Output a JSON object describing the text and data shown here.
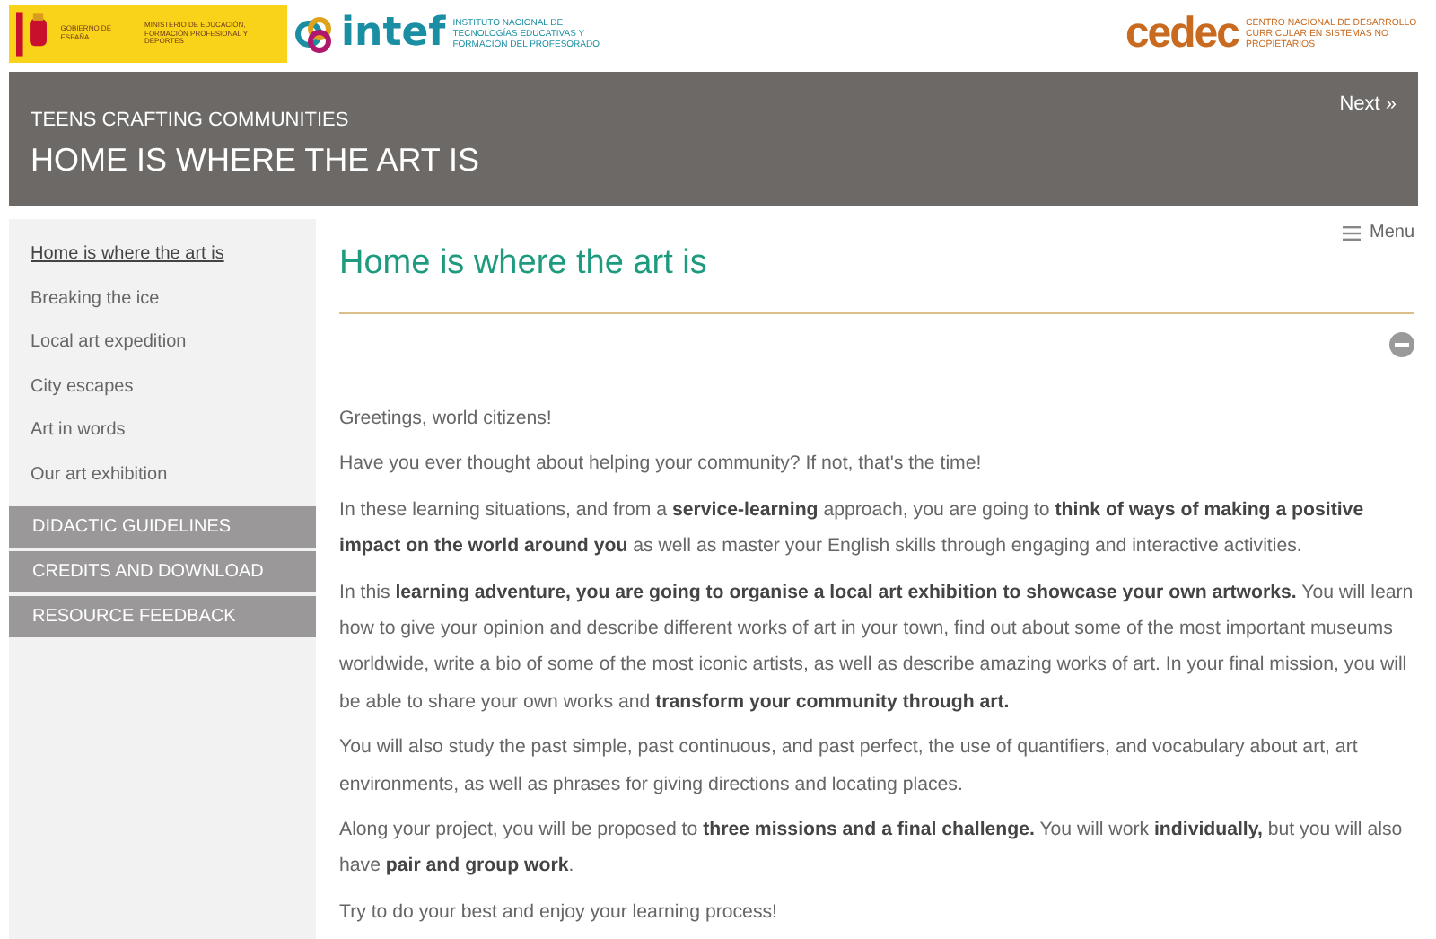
{
  "logos": {
    "gobierno": "GOBIERNO DE ESPAÑA",
    "ministerio": "MINISTERIO DE EDUCACIÓN, FORMACIÓN PROFESIONAL Y DEPORTES",
    "intef": "intef",
    "intef_caption": "INSTITUTO NACIONAL DE TECNOLOGÍAS EDUCATIVAS Y FORMACIÓN DEL PROFESORADO",
    "cedec": "cedec",
    "cedec_caption": "CENTRO NACIONAL DE DESARROLLO CURRICULAR EN SISTEMAS NO PROPIETARIOS"
  },
  "header": {
    "subtitle": "TEENS CRAFTING COMMUNITIES",
    "title": "HOME IS WHERE THE ART IS",
    "next": "Next »"
  },
  "sidebar": {
    "items": [
      {
        "label": "Home is where the art is",
        "selected": true
      },
      {
        "label": "Breaking the ice",
        "selected": false
      },
      {
        "label": "Local art expedition",
        "selected": false
      },
      {
        "label": "City escapes",
        "selected": false
      },
      {
        "label": "Art in words",
        "selected": false
      },
      {
        "label": "Our art exhibition",
        "selected": false
      }
    ],
    "sections": [
      "DIDACTIC GUIDELINES",
      "CREDITS AND DOWNLOAD",
      "RESOURCE FEEDBACK"
    ]
  },
  "content": {
    "menu": "Menu",
    "heading": "Home is where the art is",
    "paragraphs": [
      "Greetings, world citizens!",
      "Have you ever thought about helping your community? If not, that's the time!",
      "In these learning situations, and from a **service-learning** approach, you are going to **think of ways of making a positive impact on the world around you** as well as master your English skills through engaging and interactive activities.",
      "In this **learning adventure, you are going to organise a local art exhibition to showcase your own artworks.** You will learn how to give your opinion and describe different works of art in your town, find out about some of the most important museums worldwide, write a bio of some of the most iconic artists, as well as describe amazing works of art. In your final mission, you will be able to share your own works and **transform your community through art.**",
      "You will also study the past simple, past continuous, and past perfect, the use of quantifiers, and vocabulary about art, art environments, as well as phrases for giving directions and locating places.",
      "Along your project, you will be proposed to **three missions and a final challenge.** You will work **individually,** but you will also have **pair and group work**.",
      "Try to do your best and enjoy your learning process!"
    ]
  }
}
